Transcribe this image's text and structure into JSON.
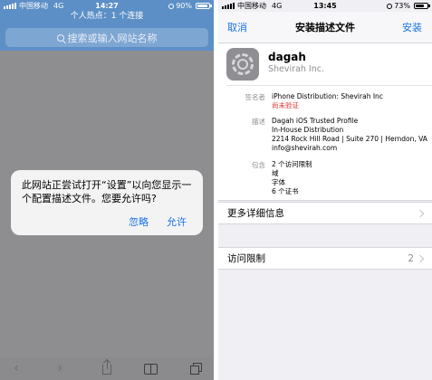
{
  "colors": {
    "accent": "#1a73e8",
    "warning": "#e0332e",
    "safari_bar": "#5c8fc6",
    "dimmed_background": "#8e8e90"
  },
  "left_phone": {
    "status": {
      "carrier": "中国移动",
      "network": "4G",
      "time": "14:27",
      "battery": "90%",
      "battery_level": 0.9
    },
    "hotspot": "个人热点：1 个连接",
    "search_placeholder": "搜索或输入网站名称",
    "alert": {
      "message": "此网站正尝试打开“设置”以向您显示一个配置描述文件。您要允许吗?",
      "ignore": "忽略",
      "allow": "允许"
    },
    "toolbar": {
      "back_glyph": "‹",
      "forward_glyph": "›",
      "icons": [
        "back-icon",
        "forward-icon",
        "share-icon",
        "bookmarks-icon",
        "tabs-icon"
      ]
    }
  },
  "right_phone": {
    "status": {
      "carrier": "中国移动",
      "network": "4G",
      "time": "13:45",
      "battery": "73%",
      "battery_level": 0.73
    },
    "nav": {
      "cancel": "取消",
      "title": "安装描述文件",
      "install": "安装"
    },
    "profile": {
      "name": "dagah",
      "org": "Shevirah Inc.",
      "icon": "settings-icon"
    },
    "details": {
      "signed_label": "签名者",
      "signed_value": "iPhone Distribution: Shevirah Inc",
      "not_verified": "尚未验证",
      "desc_label": "描述",
      "desc_lines": [
        "Dagah iOS Trusted Profile",
        "In-House Distribution",
        "2214 Rock Hill Road | Suite 270 | Herndon, VA",
        "info@shevirah.com"
      ],
      "contains_label": "包含",
      "contains_lines": [
        "2 个访问限制",
        "域",
        "字体",
        "6 个证书"
      ]
    },
    "more_details": "更多详细信息",
    "restrictions": {
      "label": "访问限制",
      "count": "2"
    }
  }
}
